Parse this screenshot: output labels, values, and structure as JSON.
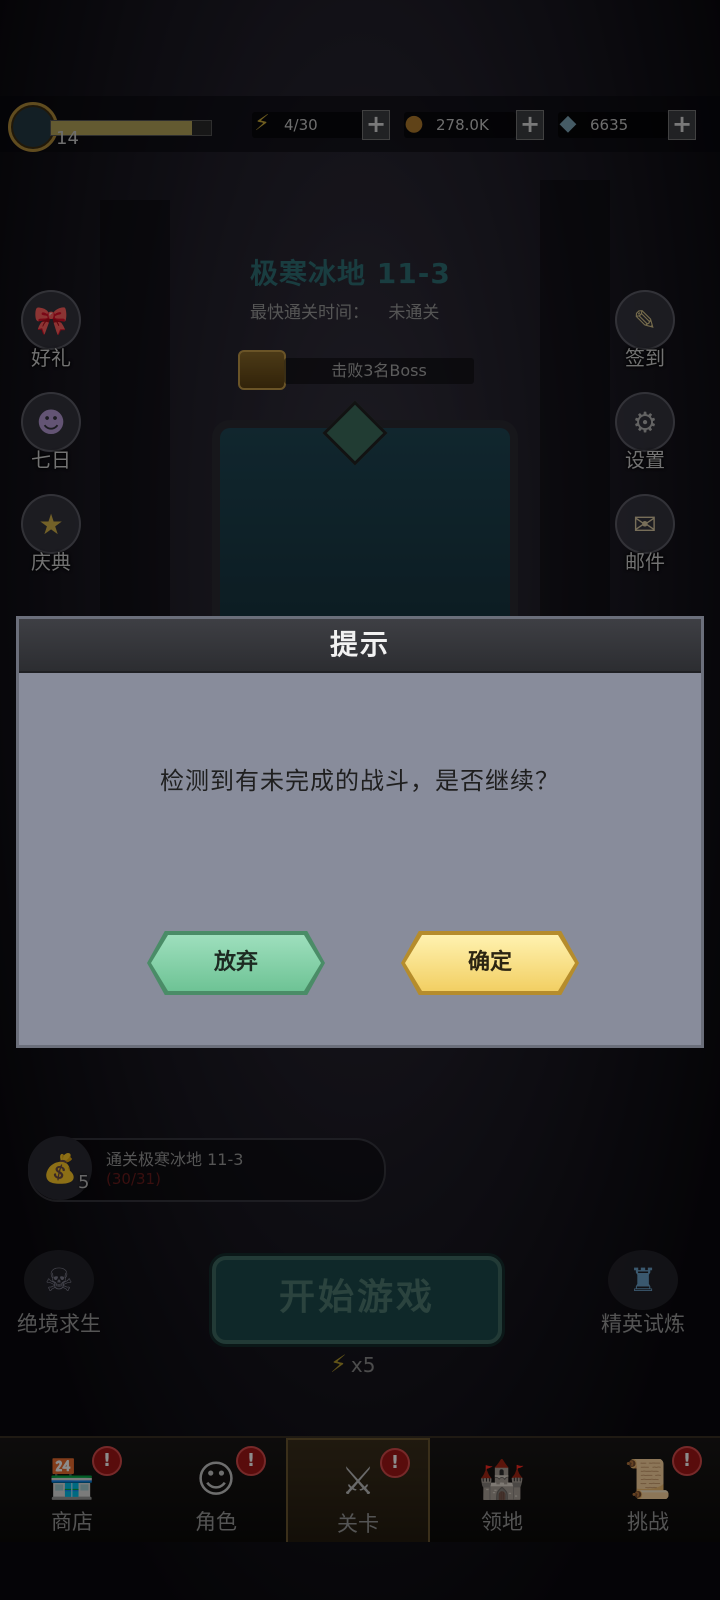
{
  "topbar": {
    "level": "14",
    "xp_fraction": 0.88,
    "energy": "4/30",
    "gold": "278.0K",
    "gems": "6635",
    "plus": "+"
  },
  "stage": {
    "title": "极寒冰地 11-3",
    "fastest_clear_label": "最快通关时间：",
    "fastest_clear_value": "未通关",
    "reward_task": "击败3名Boss"
  },
  "side_left": [
    "好礼",
    "七日",
    "庆典"
  ],
  "side_right": [
    "签到",
    "设置",
    "邮件"
  ],
  "task": {
    "title": "通关极寒冰地 11-3",
    "progress": "(30/31)",
    "count": "5"
  },
  "start": {
    "label": "开始游戏",
    "cost": "x5"
  },
  "side_big": {
    "left": "绝境求生",
    "right": "精英试炼"
  },
  "nav": [
    "商店",
    "角色",
    "关卡",
    "领地",
    "挑战"
  ],
  "dialog": {
    "title": "提示",
    "message": "检测到有未完成的战斗，是否继续？",
    "cancel": "放弃",
    "confirm": "确定"
  },
  "colors": {
    "accent_green": "#6ec395",
    "accent_gold": "#f2cf63",
    "badge_red": "#a31616"
  }
}
